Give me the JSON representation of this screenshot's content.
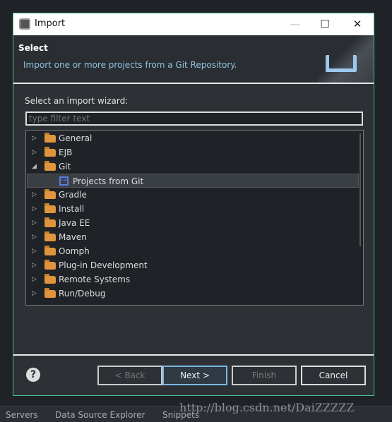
{
  "window": {
    "title": "Import",
    "minimize": "—",
    "maximize": "☐",
    "close": "✕"
  },
  "header": {
    "title": "Select",
    "description": "Import one or more projects from a Git Repository."
  },
  "wizard_label": "Select an import wizard:",
  "filter": {
    "placeholder": "type filter text",
    "value": ""
  },
  "tree": [
    {
      "label": "General",
      "expanded": false
    },
    {
      "label": "EJB",
      "expanded": false
    },
    {
      "label": "Git",
      "expanded": true
    },
    {
      "label": "Projects from Git",
      "child": true,
      "selected": true
    },
    {
      "label": "Gradle",
      "expanded": false
    },
    {
      "label": "Install",
      "expanded": false
    },
    {
      "label": "Java EE",
      "expanded": false
    },
    {
      "label": "Maven",
      "expanded": false
    },
    {
      "label": "Oomph",
      "expanded": false
    },
    {
      "label": "Plug-in Development",
      "expanded": false
    },
    {
      "label": "Remote Systems",
      "expanded": false
    },
    {
      "label": "Run/Debug",
      "expanded": false
    }
  ],
  "buttons": {
    "help": "?",
    "back": "< Back",
    "next": "Next >",
    "finish": "Finish",
    "cancel": "Cancel"
  },
  "bottom_tabs": [
    "Servers",
    "Data Source Explorer",
    "Snippets"
  ],
  "watermark": "http://blog.csdn.net/DaiZZZZZ",
  "colors": {
    "dialog_border": "#3fbf8f",
    "description": "#8fc3de",
    "folder": "#e0953d"
  }
}
